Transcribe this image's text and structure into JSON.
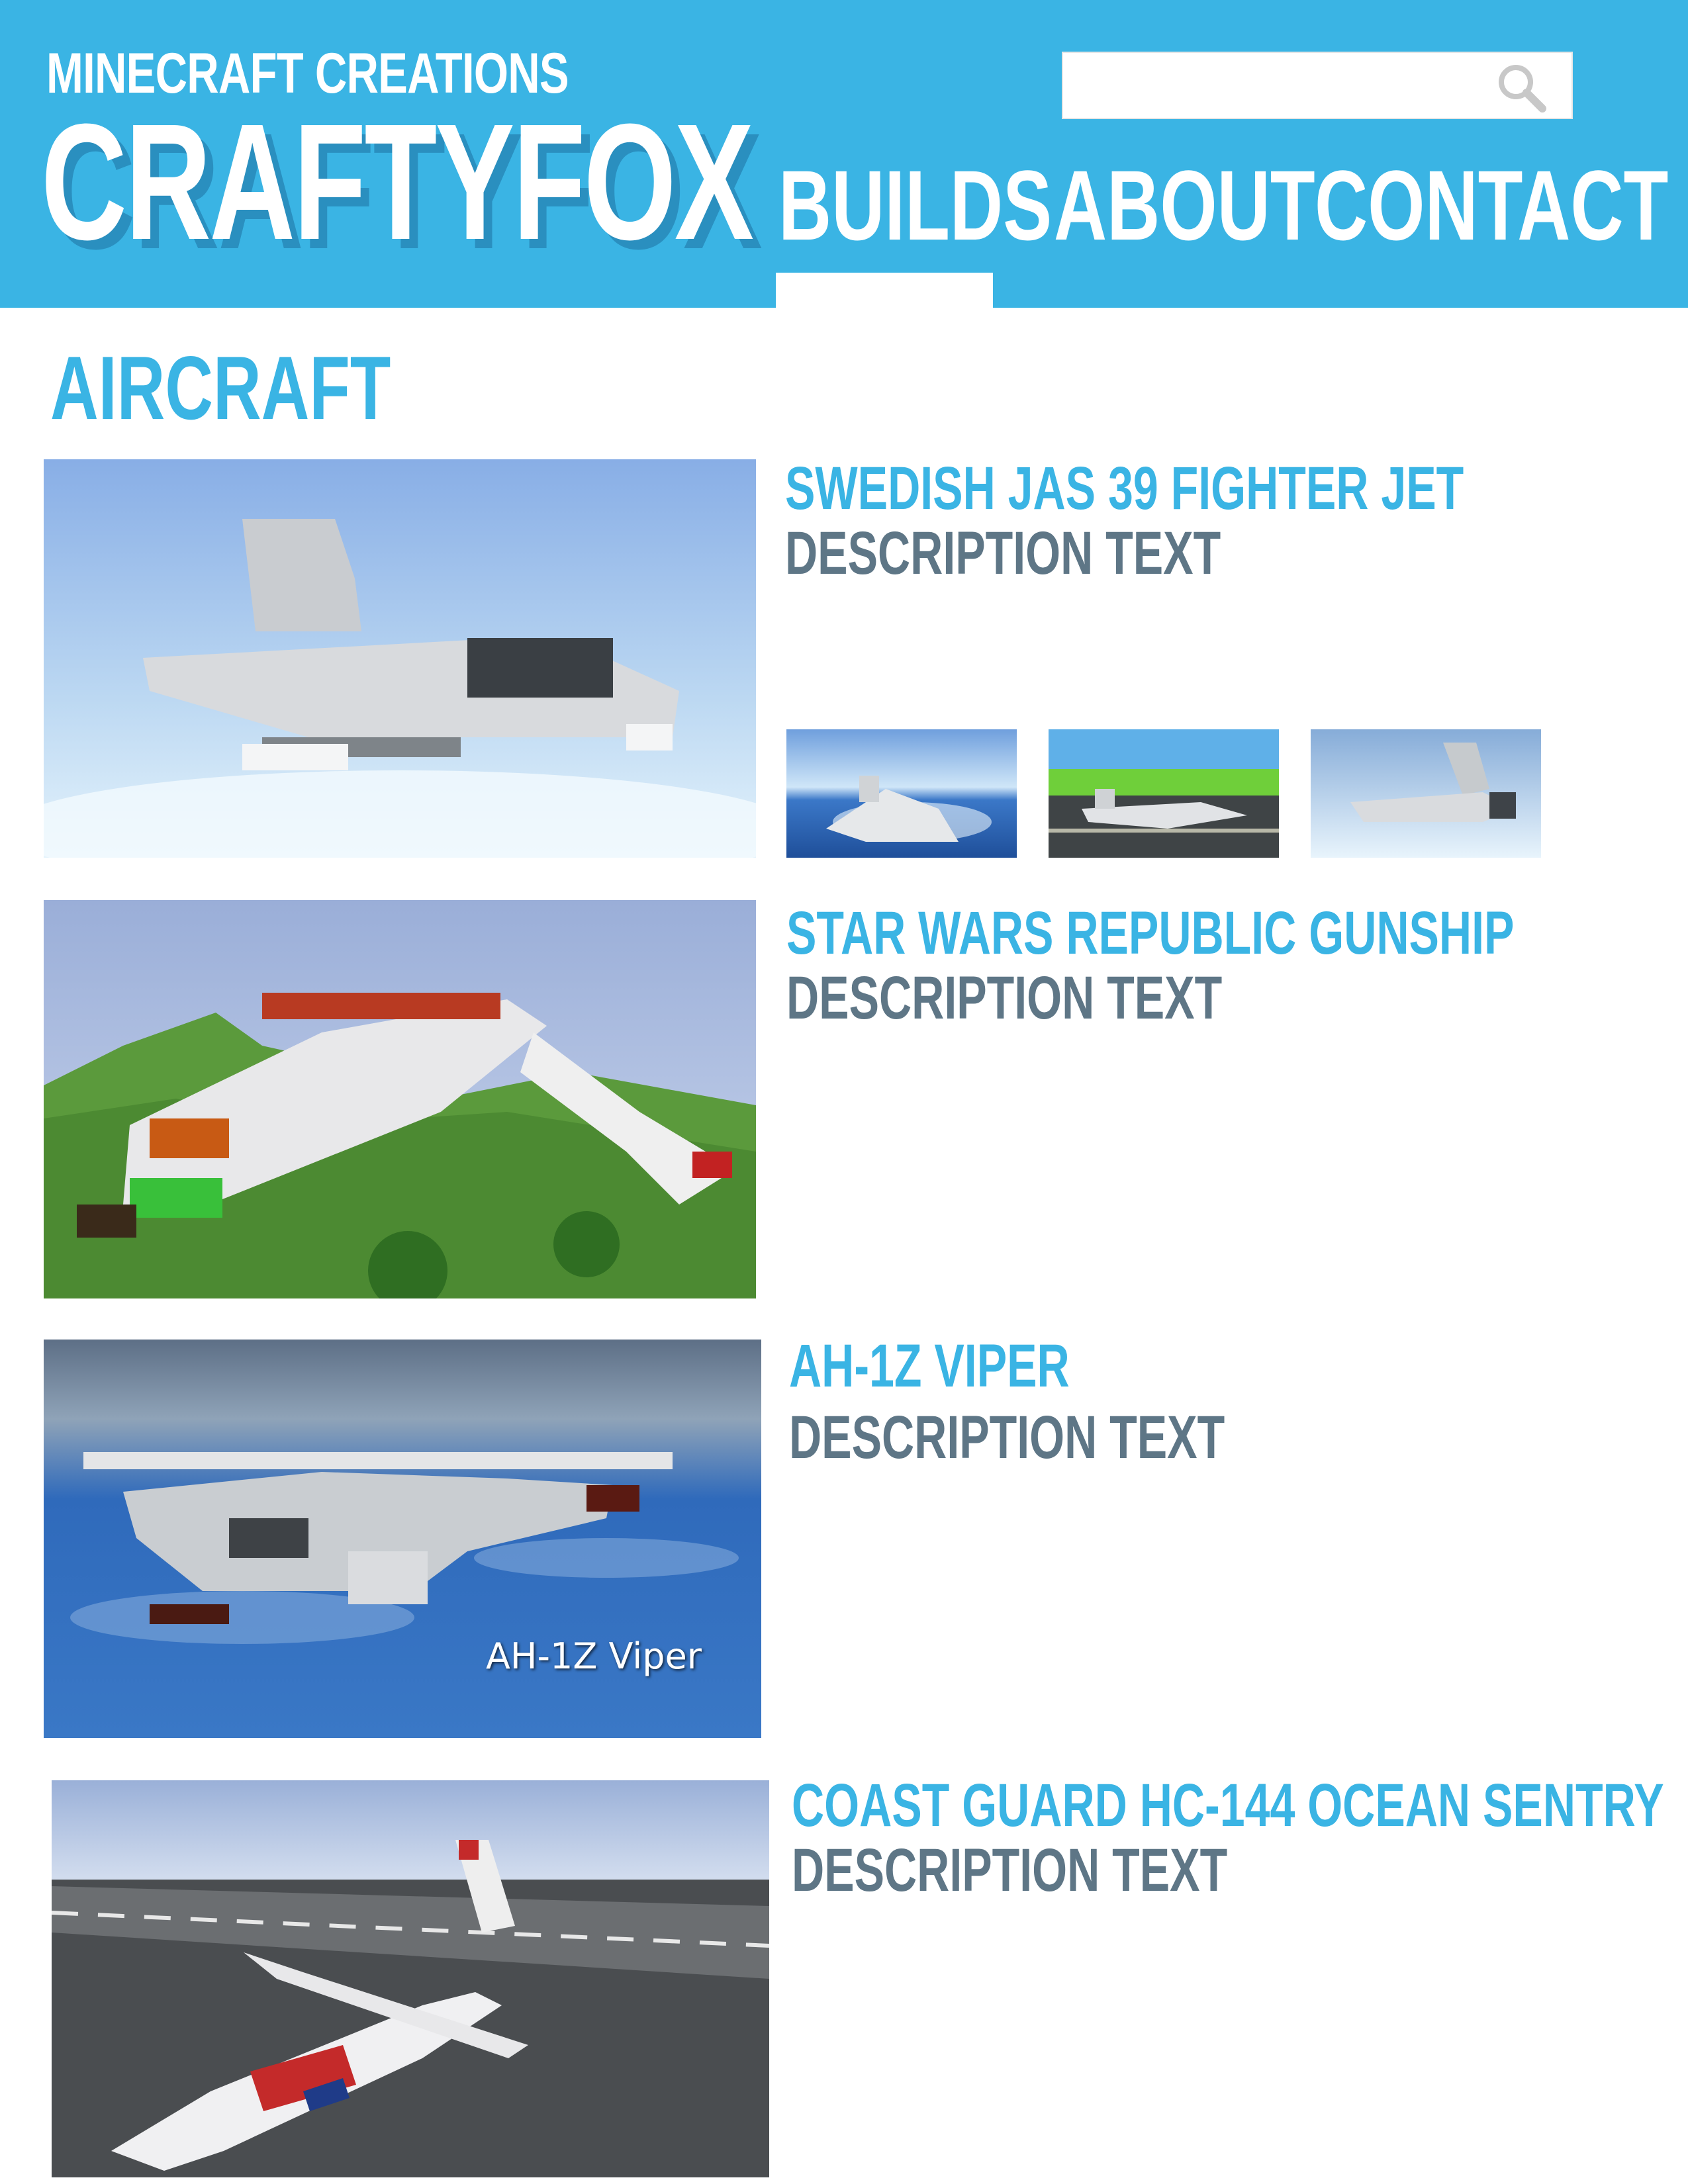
{
  "header": {
    "tagline": "MINECRAFT CREATIONS",
    "logo": "CRAFTYFOX",
    "search": {
      "value": "",
      "icon": "search-icon"
    },
    "nav": [
      {
        "label": "BUILDS",
        "active": true
      },
      {
        "label": "ABOUT",
        "active": false
      },
      {
        "label": "CONTACT",
        "active": false
      }
    ]
  },
  "section": {
    "title": "AIRCRAFT"
  },
  "builds": [
    {
      "title": "SWEDISH JAS 39 FIGHTER JET",
      "description": "DESCRIPTION TEXT",
      "thumbnails": 3
    },
    {
      "title": "STAR WARS REPUBLIC GUNSHIP",
      "description": "DESCRIPTION TEXT"
    },
    {
      "title": "AH-1Z VIPER",
      "description": "DESCRIPTION TEXT",
      "image_caption": "AH-1Z Viper"
    },
    {
      "title": "COAST GUARD HC-144 OCEAN SENTRY",
      "description": "DESCRIPTION TEXT"
    }
  ],
  "colors": {
    "brand": "#3ab4e4",
    "brand_shadow": "#2a8fbf",
    "description": "#5e7686",
    "background": "#ffffff"
  }
}
